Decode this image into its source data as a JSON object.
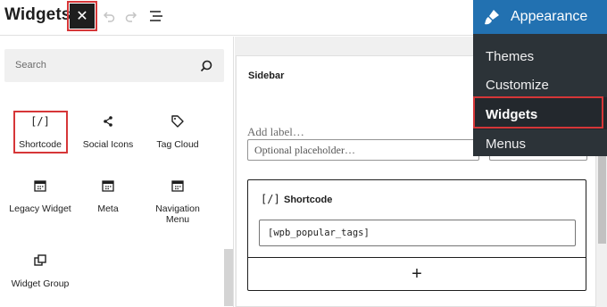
{
  "header": {
    "title": "Widgets",
    "close_icon": "close-icon",
    "undo_icon": "undo-icon",
    "redo_icon": "redo-icon",
    "list_view_icon": "list-view-icon"
  },
  "inserter": {
    "search_placeholder": "Search",
    "blocks": [
      {
        "label": "Shortcode",
        "icon": "[/]"
      },
      {
        "label": "Social Icons",
        "icon": "share-icon"
      },
      {
        "label": "Tag Cloud",
        "icon": "tag-icon"
      },
      {
        "label": "Legacy Widget",
        "icon": "calendar-icon"
      },
      {
        "label": "Meta",
        "icon": "calendar-icon"
      },
      {
        "label": "Navigation Menu",
        "icon": "calendar-icon"
      },
      {
        "label": "Widget Group",
        "icon": "group-icon"
      }
    ]
  },
  "editor": {
    "area_title": "Sidebar",
    "form_label": "Add label…",
    "form_placeholder": "Optional placeholder…",
    "shortcode_block": {
      "icon": "[/]",
      "title": "Shortcode",
      "value": "[wpb_popular_tags]"
    },
    "add_block_symbol": "+"
  },
  "admin_menu": {
    "header": "Appearance",
    "items": [
      "Themes",
      "Customize",
      "Widgets",
      "Menus"
    ],
    "current": "Widgets"
  },
  "colors": {
    "highlight": "#d63638",
    "admin_bg": "#2c3338",
    "admin_accent": "#2271b1",
    "toolbar_dark": "#1e1e1e"
  }
}
